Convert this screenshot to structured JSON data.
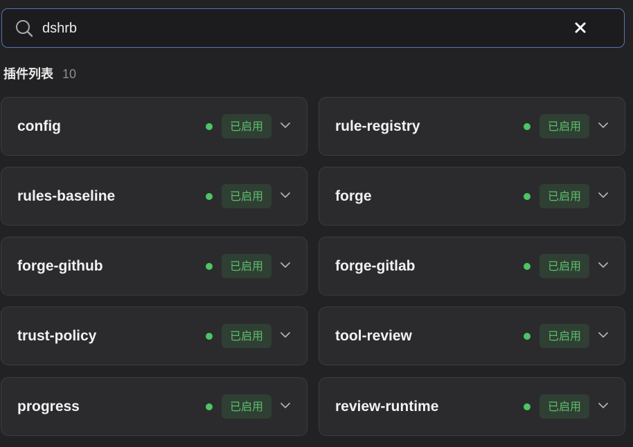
{
  "search": {
    "value": "dshrb",
    "clear_icon": "close-icon"
  },
  "section": {
    "title": "插件列表",
    "count": "10"
  },
  "status_color": "#4cc564",
  "plugins": [
    {
      "name": "config",
      "status": "已启用"
    },
    {
      "name": "rule-registry",
      "status": "已启用"
    },
    {
      "name": "rules-baseline",
      "status": "已启用"
    },
    {
      "name": "forge",
      "status": "已启用"
    },
    {
      "name": "forge-github",
      "status": "已启用"
    },
    {
      "name": "forge-gitlab",
      "status": "已启用"
    },
    {
      "name": "trust-policy",
      "status": "已启用"
    },
    {
      "name": "tool-review",
      "status": "已启用"
    },
    {
      "name": "progress",
      "status": "已启用"
    },
    {
      "name": "review-runtime",
      "status": "已启用"
    }
  ]
}
